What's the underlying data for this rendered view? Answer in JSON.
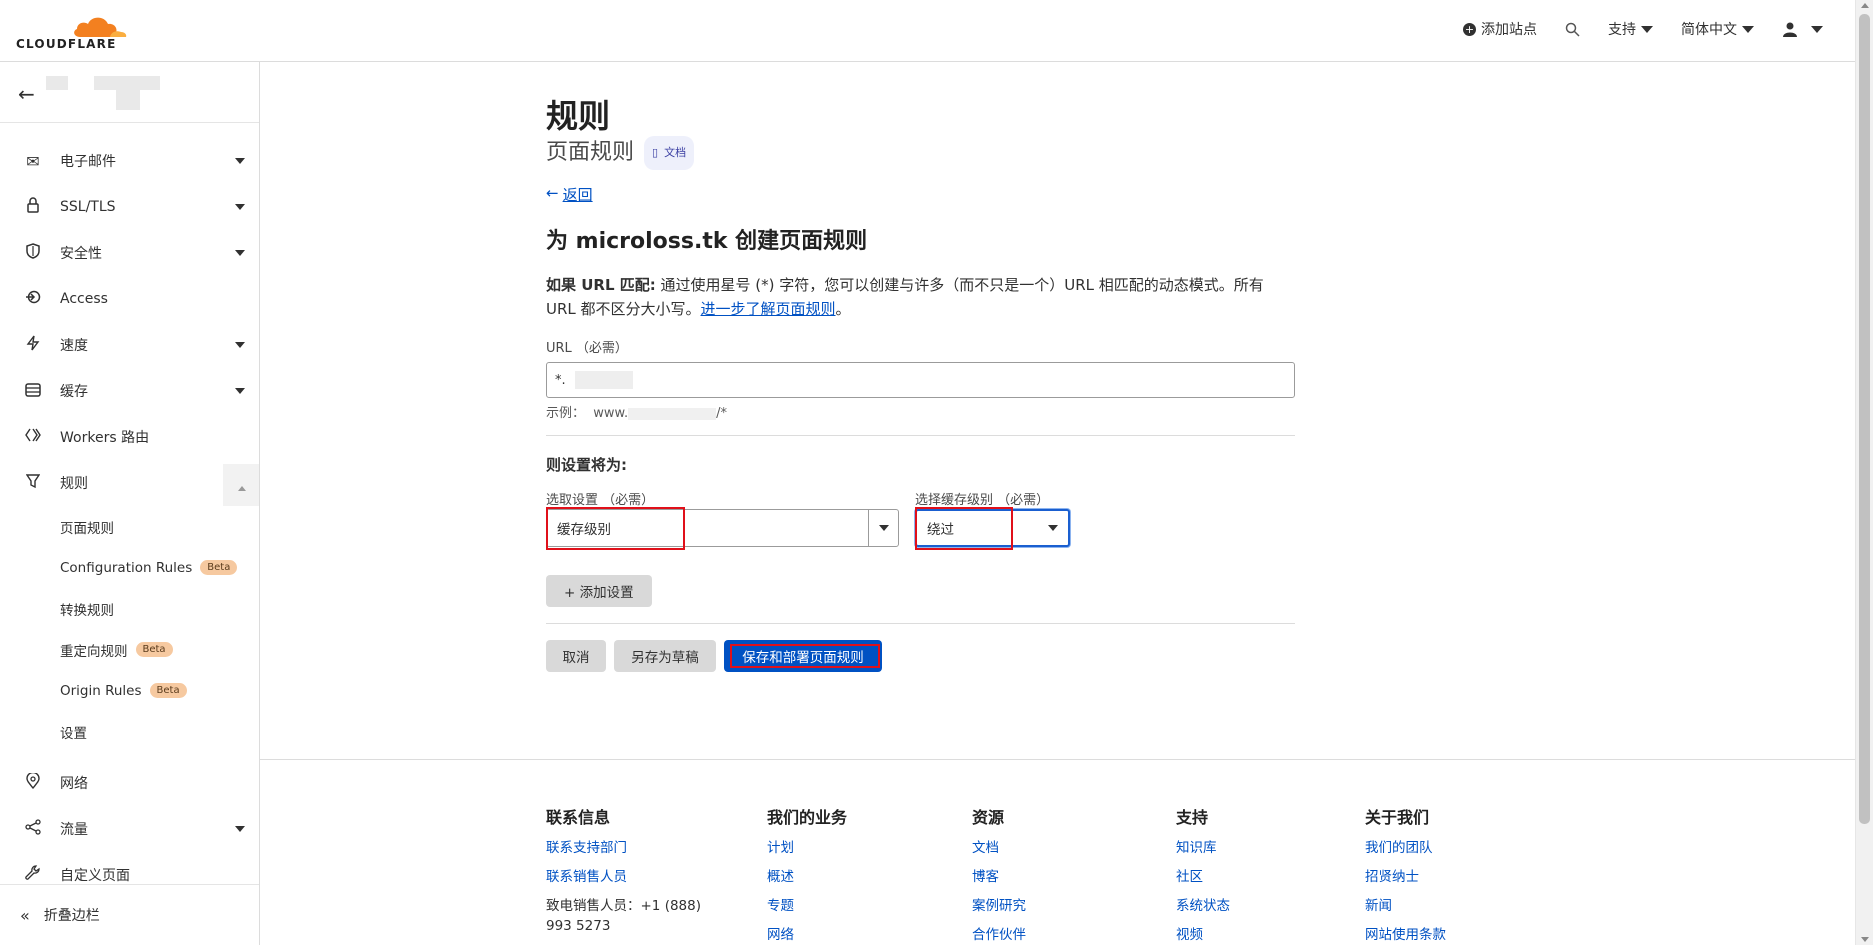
{
  "brand": {
    "logo_text": "CLOUDFLARE",
    "orange": "#f38020",
    "blue": "#0051c3"
  },
  "topbar": {
    "add_site": "添加站点",
    "support": "支持",
    "language": "简体中文"
  },
  "sidebar": {
    "items": [
      {
        "label": "电子邮件",
        "icon": "email-icon"
      },
      {
        "label": "SSL/TLS",
        "icon": "lock-icon"
      },
      {
        "label": "安全性",
        "icon": "shield-icon"
      },
      {
        "label": "Access",
        "icon": "access-icon"
      },
      {
        "label": "速度",
        "icon": "bolt-icon"
      },
      {
        "label": "缓存",
        "icon": "cache-icon"
      },
      {
        "label": "Workers 路由",
        "icon": "workers-icon"
      },
      {
        "label": "规则",
        "icon": "rules-icon"
      }
    ],
    "sub_items": [
      {
        "label": "页面规则"
      },
      {
        "label": "Configuration Rules",
        "badge": "Beta"
      },
      {
        "label": "转换规则"
      },
      {
        "label": "重定向规则",
        "badge": "Beta"
      },
      {
        "label": "Origin Rules",
        "badge": "Beta"
      },
      {
        "label": "设置"
      }
    ],
    "items_after": [
      {
        "label": "网络",
        "icon": "network-pin-icon"
      },
      {
        "label": "流量",
        "icon": "traffic-icon"
      },
      {
        "label": "自定义页面",
        "icon": "wrench-icon"
      }
    ],
    "collapse": "折叠边栏"
  },
  "main": {
    "title": "规则",
    "subtitle": "页面规则",
    "docs_badge": "文档",
    "back": "返回",
    "heading": "为 microloss.tk 创建页面规则",
    "desc_bold": "如果 URL 匹配:",
    "desc_text": " 通过使用星号 (*) 字符，您可以创建与许多（而不只是一个）URL 相匹配的动态模式。所有 URL 都不区分大小写。",
    "desc_link": "进一步了解页面规则",
    "desc_end": "。",
    "url_label": "URL （必需）",
    "url_value": "*.           /*",
    "example_prefix": "示例：  www.",
    "example_suffix": "/*",
    "settings_heading": "则设置将为:",
    "select_setting_label": "选取设置 （必需）",
    "select_setting_value": "缓存级别",
    "cache_level_label": "选择缓存级别 （必需）",
    "cache_level_value": "绕过",
    "add_setting": "+ 添加设置",
    "cancel": "取消",
    "save_draft": "另存为草稿",
    "save_deploy": "保存和部署页面规则"
  },
  "footer": {
    "columns": [
      {
        "title": "联系信息",
        "links": [
          "联系支持部门",
          "联系销售人员"
        ],
        "text": "致电销售人员：+1 (888) 993 5273"
      },
      {
        "title": "我们的业务",
        "links": [
          "计划",
          "概述",
          "专题",
          "网络"
        ]
      },
      {
        "title": "资源",
        "links": [
          "文档",
          "博客",
          "案例研究",
          "合作伙伴"
        ]
      },
      {
        "title": "支持",
        "links": [
          "知识库",
          "社区",
          "系统状态",
          "视频"
        ]
      },
      {
        "title": "关于我们",
        "links": [
          "我们的团队",
          "招贤纳士",
          "新闻",
          "网站使用条款"
        ]
      }
    ]
  }
}
